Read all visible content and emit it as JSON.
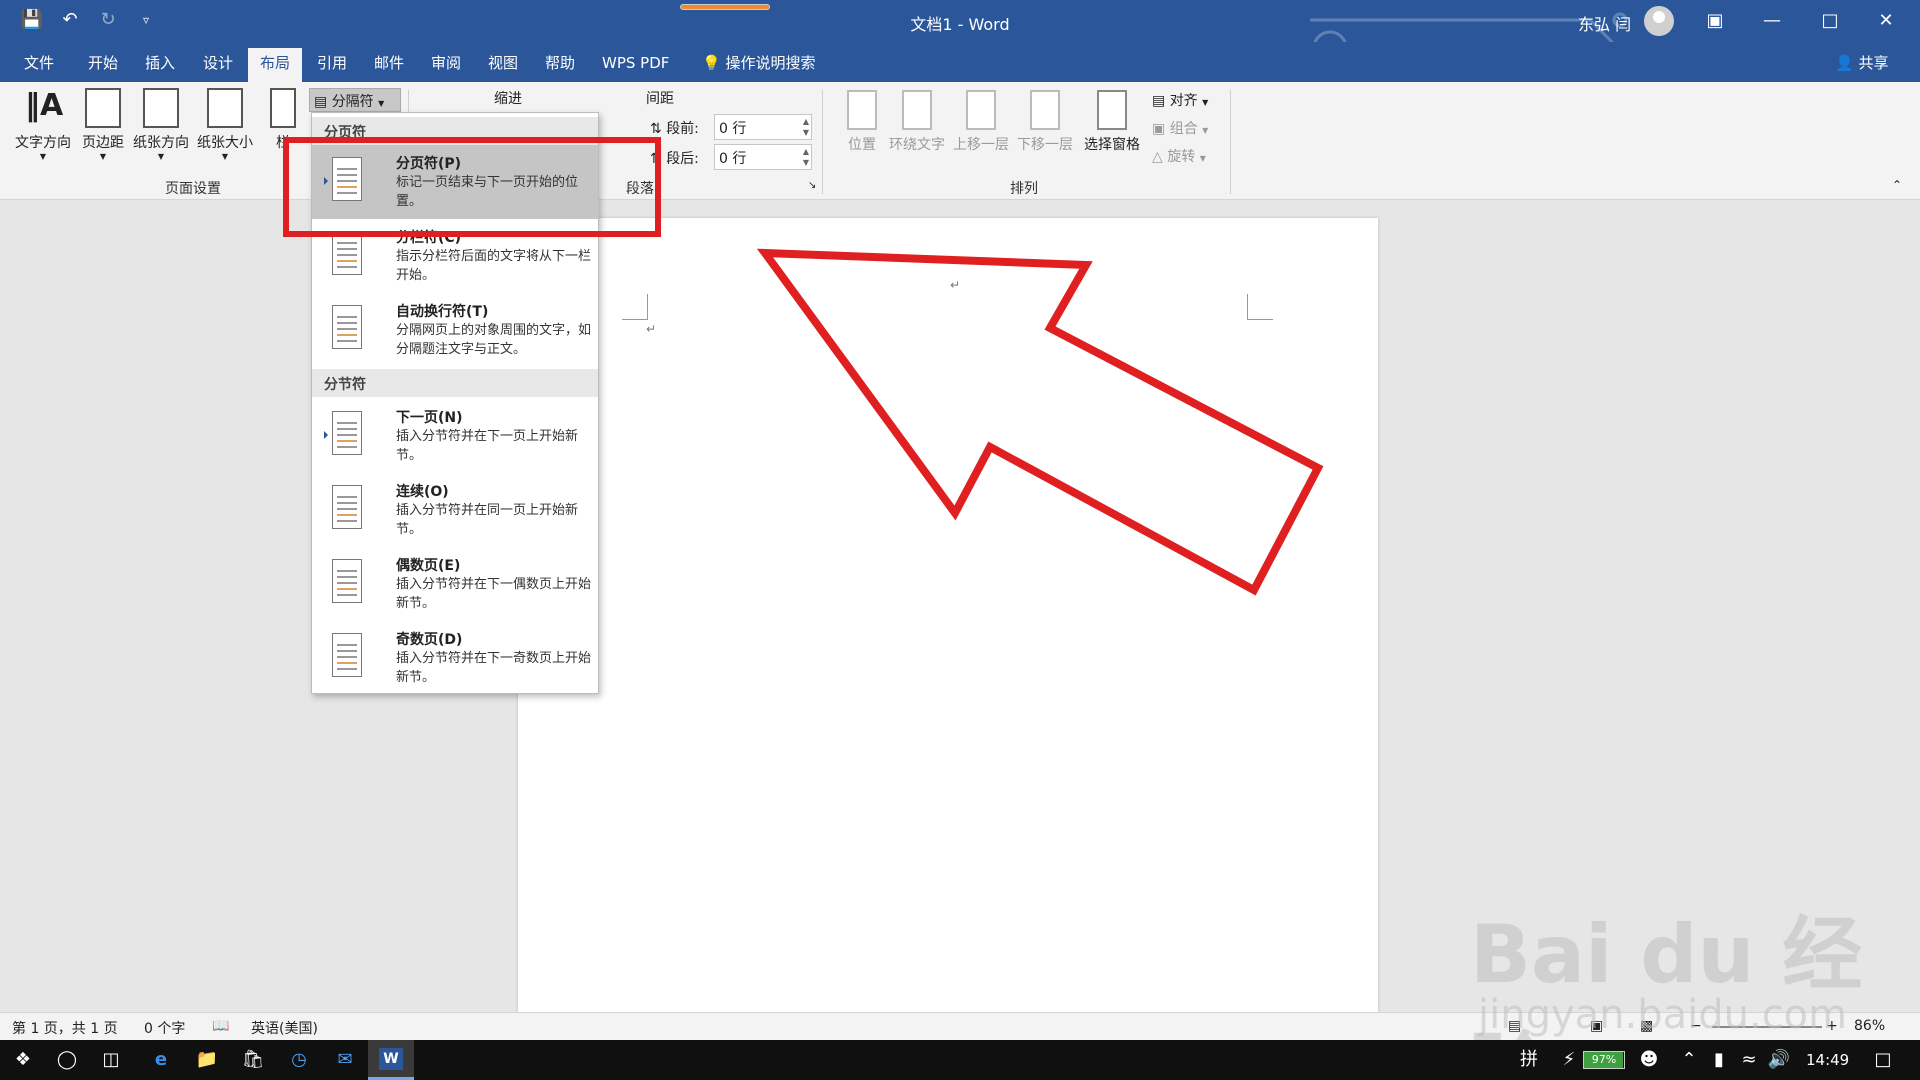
{
  "titlebar": {
    "doc_title": "文档1  -  Word",
    "user_name": "东弘 闫",
    "icons": [
      "save-icon",
      "undo-icon",
      "redo-icon",
      "customize-qat-icon"
    ]
  },
  "tabs": [
    "文件",
    "开始",
    "插入",
    "设计",
    "布局",
    "引用",
    "邮件",
    "审阅",
    "视图",
    "帮助",
    "WPS PDF"
  ],
  "active_tab": "布局",
  "tell_me": "操作说明搜索",
  "share": "共享",
  "ribbon": {
    "page_setup": {
      "text_direction": "文字方向",
      "margins": "页边距",
      "orientation": "纸张方向",
      "size": "纸张大小",
      "columns_partial": "栏",
      "breaks": "分隔符",
      "group_label": "页面设置"
    },
    "paragraph": {
      "indent_label": "缩进",
      "spacing_label": "间距",
      "before_label": "段前:",
      "after_label": "段后:",
      "before_value": "0 行",
      "after_value": "0 行",
      "group_label": "段落"
    },
    "arrange": {
      "position": "位置",
      "wrap_text": "环绕文字",
      "bring_forward": "上移一层",
      "send_backward": "下移一层",
      "selection_pane": "选择窗格",
      "align": "对齐",
      "group": "组合",
      "rotate": "旋转",
      "group_label": "排列"
    }
  },
  "menu": {
    "page_breaks_header": "分页符",
    "section_breaks_header": "分节符",
    "items": [
      {
        "title": "分页符(P)",
        "desc": "标记一页结束与下一页开始的位置。"
      },
      {
        "title": "分栏符(C)",
        "desc": "指示分栏符后面的文字将从下一栏开始。"
      },
      {
        "title": "自动换行符(T)",
        "desc": "分隔网页上的对象周围的文字，如分隔题注文字与正文。"
      },
      {
        "title": "下一页(N)",
        "desc": "插入分节符并在下一页上开始新节。"
      },
      {
        "title": "连续(O)",
        "desc": "插入分节符并在同一页上开始新节。"
      },
      {
        "title": "偶数页(E)",
        "desc": "插入分节符并在下一偶数页上开始新节。"
      },
      {
        "title": "奇数页(D)",
        "desc": "插入分节符并在下一奇数页上开始新节。"
      }
    ]
  },
  "status": {
    "page": "第 1 页，共 1 页",
    "words": "0 个字",
    "language": "英语(美国)",
    "zoom": "86%"
  },
  "taskbar": {
    "battery": "97%",
    "battery_level": 0.97,
    "ime": "拼",
    "time": "14:49"
  },
  "watermark": {
    "brand": "Bai du 经验",
    "url": "jingyan.baidu.com"
  },
  "colors": {
    "word_blue": "#2b579a",
    "highlight_red": "#e02020",
    "hover_gray": "#c5c5c5"
  }
}
